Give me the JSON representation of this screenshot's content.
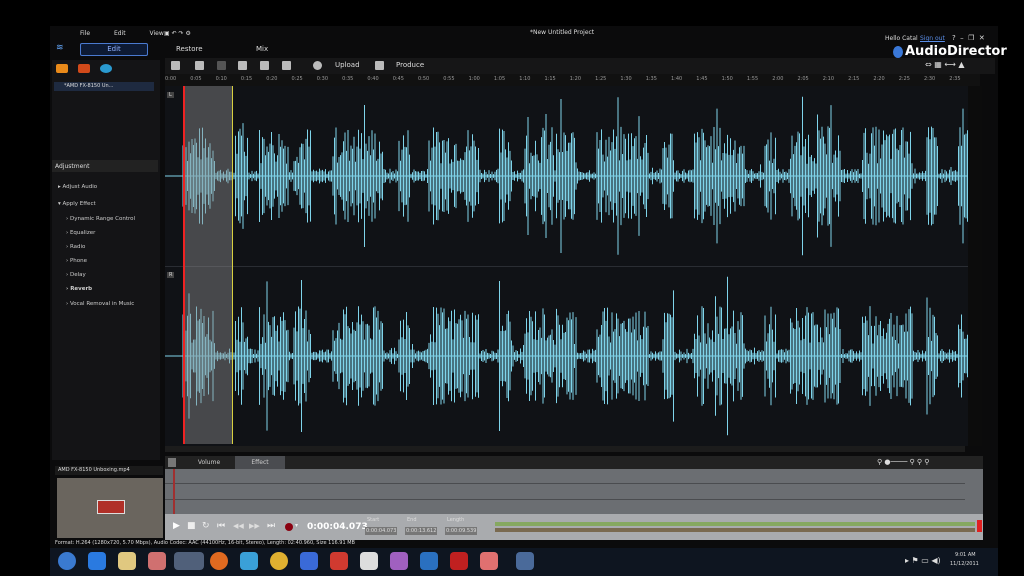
{
  "window": {
    "title": "*New Untitled Project",
    "greeting": "Hello Catal",
    "sign_out": "Sign out",
    "help": "?",
    "minimize": "–",
    "restore": "❐",
    "close": "✕",
    "brand": "AudioDirector"
  },
  "menu": [
    "File",
    "Edit",
    "View"
  ],
  "modes": {
    "edit": "Edit",
    "restore": "Restore",
    "mix": "Mix"
  },
  "toolbar": {
    "upload": "Upload",
    "produce": "Produce"
  },
  "media": {
    "item": "*AMD FX-8150 Un..."
  },
  "ruler": [
    "0:00",
    "0:05",
    "0:10",
    "0:15",
    "0:20",
    "0:25",
    "0:30",
    "0:35",
    "0:40",
    "0:45",
    "0:50",
    "0:55",
    "1:00",
    "1:05",
    "1:10",
    "1:15",
    "1:20",
    "1:25",
    "1:30",
    "1:35",
    "1:40",
    "1:45",
    "1:50",
    "1:55",
    "2:00",
    "2:05",
    "2:10",
    "2:15",
    "2:20",
    "2:25",
    "2:30",
    "2:35"
  ],
  "adjustment": {
    "title": "Adjustment",
    "groups": [
      {
        "label": "Adjust Audio",
        "expanded": false
      },
      {
        "label": "Apply Effect",
        "expanded": true
      }
    ],
    "effects": [
      "Dynamic Range Control",
      "Equalizer",
      "Radio",
      "Phone",
      "Delay",
      "Reverb",
      "Vocal Removal in Music"
    ]
  },
  "tracks": [
    "L",
    "R"
  ],
  "bottom": {
    "tabs": [
      "Volume",
      "Effect"
    ],
    "active_tab": "Effect"
  },
  "preview": {
    "title": "AMD FX-8150 Unboxing.mp4"
  },
  "transport": {
    "time": "0:00:04.073",
    "start_label": "Start",
    "start": "0:00:04.073",
    "end_label": "End",
    "end": "0:00:13.612",
    "length_label": "Length",
    "length": "0:00:09.539"
  },
  "status": "Format: H.264 (1280x720, 5.70 Mbps), Audio Codec: AAC (44100Hz, 16-bit, Stereo), Length: 02:40.960, Size 116.91 MB",
  "tray": {
    "time": "9:01 AM",
    "date": "11/12/2011"
  },
  "colors": {
    "waveform": "#7fd4ea",
    "playhead": "#e02020",
    "selection_end": "#d8d040",
    "accent": "#4a7ad0"
  }
}
